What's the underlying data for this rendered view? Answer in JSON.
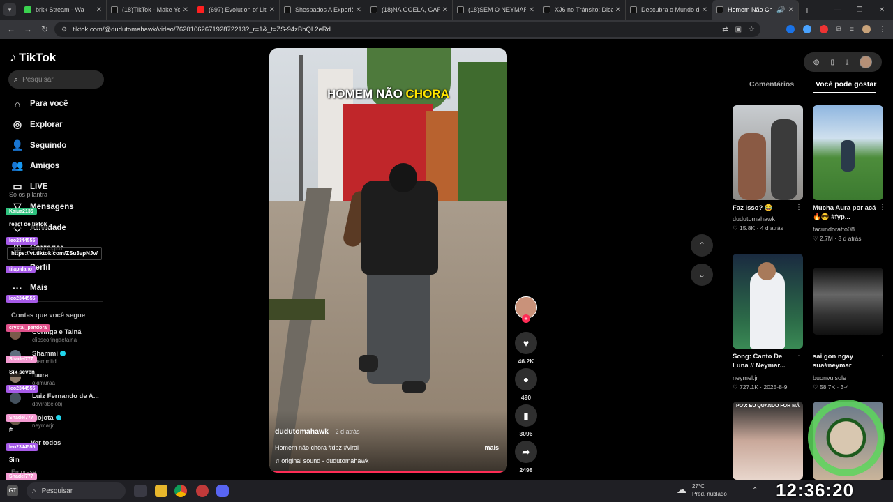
{
  "browser": {
    "tabs": [
      {
        "title": "brkk Stream - Wa",
        "color": "#3ad24f"
      },
      {
        "title": "(18)TikTok - Make Yo",
        "color": "#ffffff"
      },
      {
        "title": "(697) Evolution of Lit",
        "color": "#ff2020"
      },
      {
        "title": "Shespados A Experiê",
        "color": "#ffffff"
      },
      {
        "title": "(18)NA GOELA, GAR",
        "color": "#ffffff"
      },
      {
        "title": "(18)SEM O NEYMAR",
        "color": "#ffffff"
      },
      {
        "title": "XJ6 no Trânsito: Dica",
        "color": "#ffffff"
      },
      {
        "title": "Descubra o Mundo d",
        "color": "#ffffff"
      },
      {
        "title": "Homem Não Ch",
        "color": "#ffffff"
      }
    ],
    "url": "tiktok.com/@dudutomahawk/video/7620106267192872213?_r=1&_t=ZS-94zBbQL2eRd"
  },
  "sidebar": {
    "logo": "TikTok",
    "search_placeholder": "Pesquisar",
    "nav": {
      "for_you": "Para você",
      "explore": "Explorar",
      "following": "Seguindo",
      "friends": "Amigos",
      "live": "LIVE",
      "messages": "Mensagens",
      "activity": "Atividade",
      "upload": "Carregar",
      "profile": "Perfil",
      "more": "Mais"
    },
    "live_sub": "Só os pilantra",
    "following_header": "Contas que você segue",
    "accounts": [
      {
        "name": "Coringa e Tainá",
        "handle": "clipscoringaetaina"
      },
      {
        "name": "Shammi",
        "handle": "shammitd",
        "verified": true
      },
      {
        "name": "mura",
        "handle": "oximuraa"
      },
      {
        "name": "Luiz Fernando de A...",
        "handle": "davirabelobj"
      },
      {
        "name": "Mojota",
        "handle": "neymarjr",
        "verified": true
      }
    ],
    "see_all": "Ver todos",
    "footer": "Empresa"
  },
  "chat_overlay": [
    {
      "user": "Kaiua2135",
      "color": "#2ec27e",
      "message": "react de tiktok"
    },
    {
      "user": "leo2344555",
      "color": "#a65ae8",
      "message": "https://vt.tiktok.com/ZSu3vpNJv/"
    },
    {
      "user": "tilapidano",
      "color": "#a65ae8",
      "message": ""
    },
    {
      "user": "leo2344555",
      "color": "#a65ae8",
      "message": ""
    },
    {
      "user": "crystal_pendora",
      "color": "#e0508a",
      "message": ""
    },
    {
      "user": "Shadel777",
      "color": "#f59bd2",
      "message": "Six seven"
    },
    {
      "user": "leo2344555",
      "color": "#a65ae8",
      "message": ""
    },
    {
      "user": "Shadel777",
      "color": "#f59bd2",
      "message": "É"
    },
    {
      "user": "leo2344555",
      "color": "#a65ae8",
      "message": "Sim"
    },
    {
      "user": "Shadel777",
      "color": "#f59bd2",
      "message": ""
    }
  ],
  "video": {
    "caption_prefix": "HOMEM NÃO",
    "caption_highlight": "CHORA",
    "author": "dudutomahawk",
    "date": "· 2 d atrás",
    "description": "Homem não chora #dbz #viral",
    "more": "mais",
    "sound": "♫  original sound - dudutomahawk"
  },
  "actions": {
    "likes": "46.2K",
    "comments": "490",
    "saves": "3096",
    "shares": "2498"
  },
  "right_panel": {
    "tab_comments": "Comentários",
    "tab_you_may_like": "Você pode gostar",
    "videos": [
      {
        "title": "Faz isso? 😂",
        "author": "dudutomahawk",
        "meta": "♡ 15.8K · 4 d atrás"
      },
      {
        "title": "Mucha Aura por acá 🔥😎 #fyp...",
        "author": "facundoratto08",
        "meta": "♡ 2.7M · 3 d atrás"
      },
      {
        "title": "Song: Canto De Luna // Neymar...",
        "author": "neymel.jr",
        "meta": "♡ 727.1K · 2025-8-9"
      },
      {
        "title": "sai gon ngay sua#neymar",
        "author": "buonvuisole",
        "meta": "♡ 58.7K · 3-4"
      }
    ],
    "thumb5_caption": "POV: EU QUANDO FOR MÃ"
  },
  "taskbar": {
    "search": "Pesquisar",
    "weather_temp": "27°C",
    "weather_desc": "Pred. nublado",
    "clock": "12:36:20"
  }
}
